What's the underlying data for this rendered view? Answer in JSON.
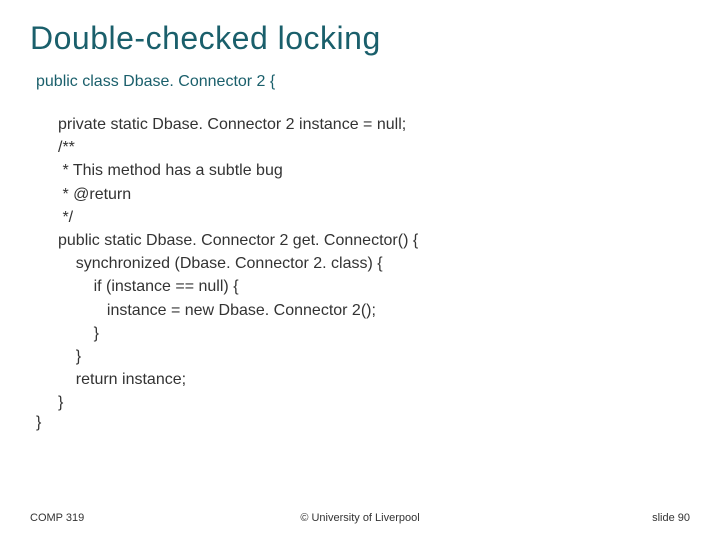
{
  "title": "Double-checked locking",
  "declaration": "public class Dbase. Connector 2 {",
  "code_lines": [
    "private static Dbase. Connector 2 instance = null;",
    "/**",
    " * This method has a subtle bug",
    " * @return",
    " */",
    "public static Dbase. Connector 2 get. Connector() {",
    "    synchronized (Dbase. Connector 2. class) {",
    "        if (instance == null) {",
    "           instance = new Dbase. Connector 2();",
    "        }",
    "    }",
    "    return instance;",
    "}"
  ],
  "close_brace": "}",
  "footer": {
    "left": "COMP 319",
    "center": "© University of Liverpool",
    "right": "slide  90"
  }
}
